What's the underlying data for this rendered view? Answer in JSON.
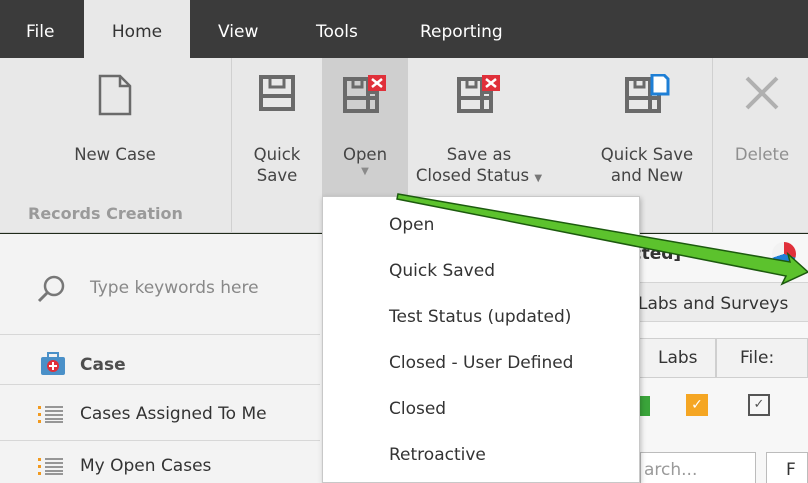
{
  "tabs": [
    {
      "label": "File",
      "active": false
    },
    {
      "label": "Home",
      "active": true
    },
    {
      "label": "View",
      "active": false
    },
    {
      "label": "Tools",
      "active": false
    },
    {
      "label": "Reporting",
      "active": false
    }
  ],
  "ribbon": {
    "new_case": "New Case",
    "quick_save_line1": "Quick",
    "quick_save_line2": "Save",
    "open": "Open",
    "save_closed_line1": "Save as",
    "save_closed_line2": "Closed Status",
    "quick_save_new_line1": "Quick Save",
    "quick_save_new_line2": "and New",
    "delete": "Delete",
    "group_label": "Records Creation"
  },
  "sidebar": {
    "search_placeholder": "Type keywords here",
    "section": "Case",
    "items": [
      {
        "label": "Cases Assigned To Me"
      },
      {
        "label": "My Open Cases"
      }
    ]
  },
  "background": {
    "selected_label": "ected]",
    "labs_surveys": "Labs and Surveys",
    "tab_labs": "Labs",
    "tab_files": "File:",
    "search_partial": "arch...",
    "partial_f": "F"
  },
  "dropdown": {
    "items": [
      {
        "label": "Open"
      },
      {
        "label": "Quick Saved"
      },
      {
        "label": "Test Status (updated)"
      },
      {
        "label": "Closed - User Defined"
      },
      {
        "label": "Closed"
      },
      {
        "label": "Retroactive"
      }
    ]
  },
  "colors": {
    "tabbar": "#3b3b3b",
    "ribbon": "#e8e8e8",
    "red_x": "#e0303a",
    "blue_doc": "#1e7fd6",
    "arrow_green": "#5cc22d"
  }
}
